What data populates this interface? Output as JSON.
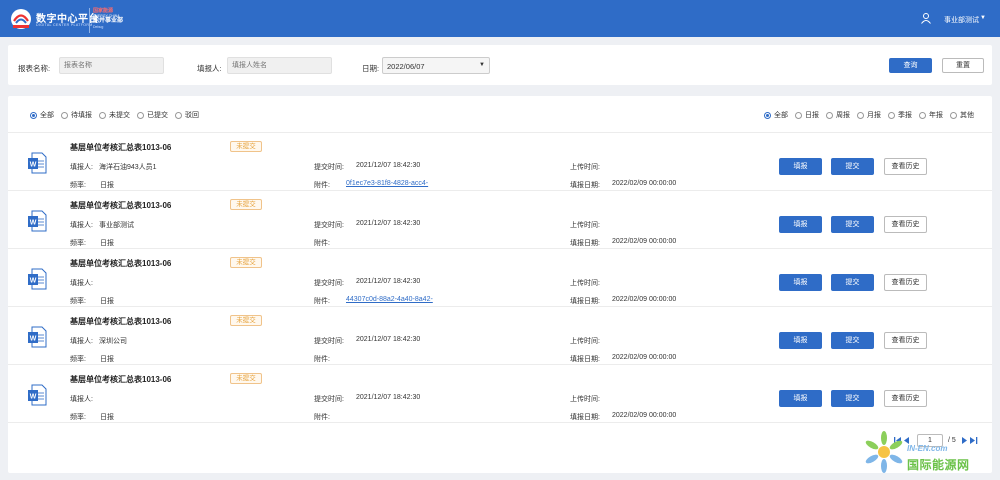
{
  "header": {
    "app_title": "数字中心平台",
    "app_subtitle": "DIGITAL CENTER PLATFORM",
    "sub_brand_line1": "国家能源",
    "sub_brand_line2": "ENERGY CHINA",
    "sub_brand_line3": "能并事业部",
    "sub_brand_line4": "Debug",
    "user_name": "事业部测试"
  },
  "filters": {
    "report_name_label": "报表名称:",
    "report_name_placeholder": "报表名称",
    "filler_label": "填报人:",
    "filler_placeholder": "填报人姓名",
    "date_label": "日期:",
    "date_value": "2022/06/07",
    "query_button": "查询",
    "reset_button": "重置"
  },
  "status_filter": {
    "options": [
      "全部",
      "待填报",
      "未提交",
      "已提交",
      "驳回"
    ],
    "selected": "全部"
  },
  "period_filter": {
    "options": [
      "全部",
      "日报",
      "周报",
      "月报",
      "季报",
      "年报",
      "其他"
    ],
    "selected": "全部"
  },
  "labels": {
    "filler": "填报人:",
    "submit_time": "提交时间:",
    "upload_time": "上传时间:",
    "frequency": "频率:",
    "attachment": "附件:",
    "fill_date": "填报日期:",
    "fill_button": "填报",
    "submit_button": "提交",
    "history_button": "查看历史"
  },
  "rows": [
    {
      "title": "基层单位考核汇总表1013-06",
      "status": "未提交",
      "filler": "海洋石油943人员1",
      "submit_time": "2021/12/07 18:42:30",
      "upload_time": "",
      "frequency": "日报",
      "attachment": "0f1ec7e3-81f8-4828-acc4-",
      "fill_date": "2022/02/09 00:00:00"
    },
    {
      "title": "基层单位考核汇总表1013-06",
      "status": "未提交",
      "filler": "事业部测试",
      "submit_time": "2021/12/07 18:42:30",
      "upload_time": "",
      "frequency": "日报",
      "attachment": "",
      "fill_date": "2022/02/09 00:00:00"
    },
    {
      "title": "基层单位考核汇总表1013-06",
      "status": "未提交",
      "filler": "",
      "submit_time": "2021/12/07 18:42:30",
      "upload_time": "",
      "frequency": "日报",
      "attachment": "44307c0d-88a2-4a40-8a42-",
      "fill_date": "2022/02/09 00:00:00"
    },
    {
      "title": "基层单位考核汇总表1013-06",
      "status": "未提交",
      "filler": "深圳公司",
      "submit_time": "2021/12/07 18:42:30",
      "upload_time": "",
      "frequency": "日报",
      "attachment": "",
      "fill_date": "2022/02/09 00:00:00"
    },
    {
      "title": "基层单位考核汇总表1013-06",
      "status": "未提交",
      "filler": "",
      "submit_time": "2021/12/07 18:42:30",
      "upload_time": "",
      "frequency": "日报",
      "attachment": "",
      "fill_date": "2022/02/09 00:00:00"
    }
  ],
  "pagination": {
    "current_page": "1",
    "total_pages": "/ 5"
  },
  "watermark": {
    "en": "IN-EN.com",
    "cn": "国际能源网"
  },
  "colors": {
    "primary": "#2f6cc7",
    "badge_text": "#e6a23c",
    "watermark_green": "#6cc24a"
  }
}
